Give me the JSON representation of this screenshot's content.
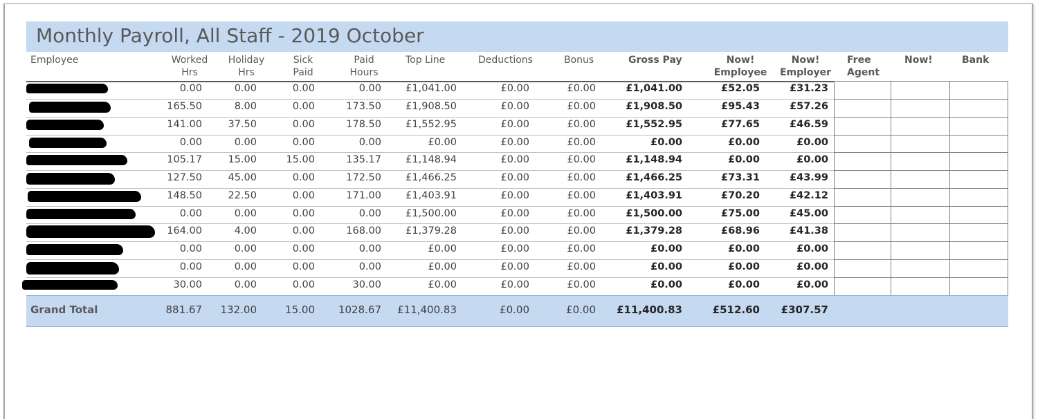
{
  "report": {
    "title": "Monthly Payroll, All Staff - 2019 October"
  },
  "headers": {
    "employee": "Employee",
    "worked": [
      "Worked",
      "Hrs"
    ],
    "holiday": [
      "Holiday",
      "Hrs"
    ],
    "sick": [
      "Sick",
      "Paid"
    ],
    "paid": [
      "Paid",
      "Hours"
    ],
    "topline": "Top Line",
    "deductions": "Deductions",
    "bonus": "Bonus",
    "gross": "Gross Pay",
    "now_employee": [
      "Now!",
      "Employee"
    ],
    "now_employer": [
      "Now!",
      "Employer"
    ],
    "free_agent": [
      "Free",
      "Agent"
    ],
    "now": "Now!",
    "bank": "Bank"
  },
  "rows": [
    [
      "0.00",
      "0.00",
      "0.00",
      "0.00",
      "£1,041.00",
      "£0.00",
      "£0.00",
      "£1,041.00",
      "£52.05",
      "£31.23"
    ],
    [
      "165.50",
      "8.00",
      "0.00",
      "173.50",
      "£1,908.50",
      "£0.00",
      "£0.00",
      "£1,908.50",
      "£95.43",
      "£57.26"
    ],
    [
      "141.00",
      "37.50",
      "0.00",
      "178.50",
      "£1,552.95",
      "£0.00",
      "£0.00",
      "£1,552.95",
      "£77.65",
      "£46.59"
    ],
    [
      "0.00",
      "0.00",
      "0.00",
      "0.00",
      "£0.00",
      "£0.00",
      "£0.00",
      "£0.00",
      "£0.00",
      "£0.00"
    ],
    [
      "105.17",
      "15.00",
      "15.00",
      "135.17",
      "£1,148.94",
      "£0.00",
      "£0.00",
      "£1,148.94",
      "£0.00",
      "£0.00"
    ],
    [
      "127.50",
      "45.00",
      "0.00",
      "172.50",
      "£1,466.25",
      "£0.00",
      "£0.00",
      "£1,466.25",
      "£73.31",
      "£43.99"
    ],
    [
      "148.50",
      "22.50",
      "0.00",
      "171.00",
      "£1,403.91",
      "£0.00",
      "£0.00",
      "£1,403.91",
      "£70.20",
      "£42.12"
    ],
    [
      "0.00",
      "0.00",
      "0.00",
      "0.00",
      "£1,500.00",
      "£0.00",
      "£0.00",
      "£1,500.00",
      "£75.00",
      "£45.00"
    ],
    [
      "164.00",
      "4.00",
      "0.00",
      "168.00",
      "£1,379.28",
      "£0.00",
      "£0.00",
      "£1,379.28",
      "£68.96",
      "£41.38"
    ],
    [
      "0.00",
      "0.00",
      "0.00",
      "0.00",
      "£0.00",
      "£0.00",
      "£0.00",
      "£0.00",
      "£0.00",
      "£0.00"
    ],
    [
      "0.00",
      "0.00",
      "0.00",
      "0.00",
      "£0.00",
      "£0.00",
      "£0.00",
      "£0.00",
      "£0.00",
      "£0.00"
    ],
    [
      "30.00",
      "0.00",
      "0.00",
      "30.00",
      "£0.00",
      "£0.00",
      "£0.00",
      "£0.00",
      "£0.00",
      "£0.00"
    ]
  ],
  "totals": {
    "label": "Grand Total",
    "values": [
      "881.67",
      "132.00",
      "15.00",
      "1028.67",
      "£11,400.83",
      "£0.00",
      "£0.00",
      "£11,400.83",
      "£512.60",
      "£307.57"
    ]
  },
  "colors": {
    "band": "#c5d9f1",
    "text": "#595959",
    "redaction": "#000000"
  }
}
